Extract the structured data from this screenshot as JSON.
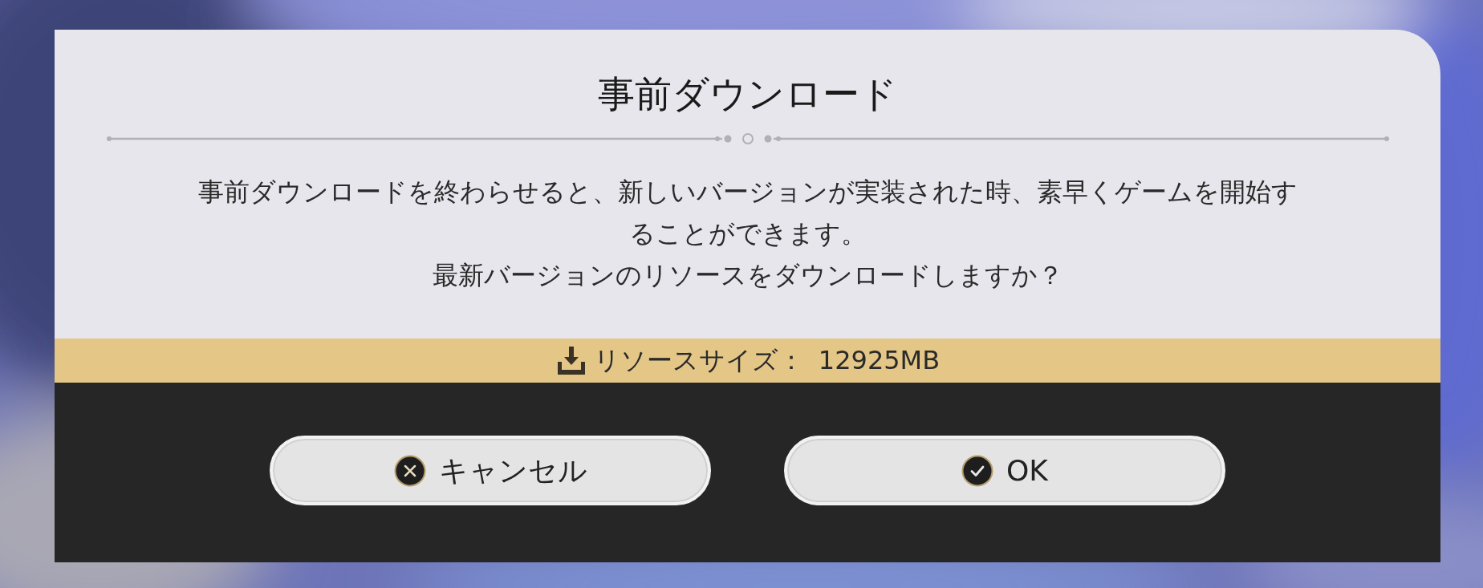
{
  "dialog": {
    "title": "事前ダウンロード",
    "paragraphs": [
      "事前ダウンロードを終わらせると、新しいバージョンが実装された時、素早くゲームを開始することができます。",
      "最新バージョンのリソースをダウンロードしますか？"
    ],
    "resource": {
      "label": "リソースサイズ：",
      "value": "12925MB"
    },
    "buttons": [
      {
        "kind": "cancel",
        "label": "キャンセル"
      },
      {
        "kind": "confirm",
        "label": "OK"
      }
    ]
  }
}
